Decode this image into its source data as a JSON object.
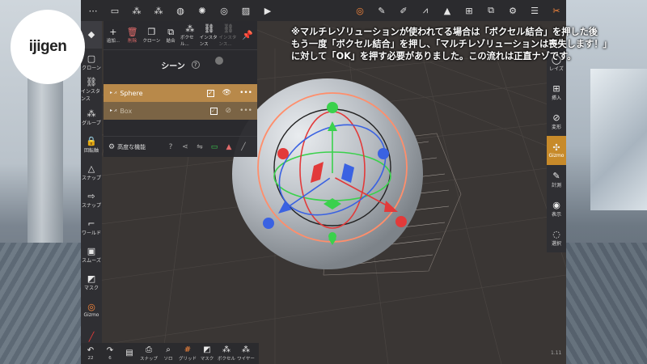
{
  "logo": {
    "text": "ijigen"
  },
  "caption": {
    "lines": [
      "※マルチレゾリューションが使われてる場合は「ボクセル結合」を押した後",
      "もう一度「ボクセル結合」を押し、「マルチレゾリューションは喪失します！」",
      "に対して「OK」を押す必要がありました。この流れは正直ナゾです。"
    ]
  },
  "scene_panel": {
    "tools": [
      {
        "icon": "+",
        "label": "追加..."
      },
      {
        "icon": "🗑",
        "label": "削除"
      },
      {
        "icon": "❐",
        "label": "クローン"
      },
      {
        "icon": "⧉",
        "label": "結合"
      },
      {
        "icon": "⁂",
        "label": "ボクセル..."
      },
      {
        "icon": "⛓",
        "label": "インスタンス"
      },
      {
        "icon": "⛓",
        "label": "インスタンス..."
      },
      {
        "icon": "📌",
        "label": ""
      }
    ],
    "title": "シーン",
    "help": "?",
    "objects": [
      {
        "name": "Sphere",
        "checked": "✓",
        "eye": "👁",
        "more": "•••"
      },
      {
        "name": "Box",
        "checked": "✓",
        "eye": "⊘",
        "more": "•••"
      }
    ],
    "advanced": "高度な機能"
  },
  "left_toolbar": [
    {
      "icon": "◆",
      "label": ""
    },
    {
      "icon": "▢",
      "label": "クローン"
    },
    {
      "icon": "⛓",
      "label": "インスタンス"
    },
    {
      "icon": "⁂",
      "label": "グループ"
    },
    {
      "icon": "🔒",
      "label": "回転軸"
    },
    {
      "icon": "△",
      "label": "スナップ"
    },
    {
      "icon": "⇨",
      "label": "スナップ"
    },
    {
      "icon": "⌐",
      "label": "ワールド"
    },
    {
      "icon": "▣",
      "label": "スムーズ"
    },
    {
      "icon": "◩",
      "label": "マスク"
    },
    {
      "icon": "◎",
      "label": "Gizmo"
    },
    {
      "icon": "╱",
      "label": ""
    }
  ],
  "right_toolbar": [
    {
      "icon": "◯",
      "label": "レイズ"
    },
    {
      "icon": "⊞",
      "label": "挿入"
    },
    {
      "icon": "⊘",
      "label": "変形"
    },
    {
      "icon": "✣",
      "label": "Gizmo"
    },
    {
      "icon": "✎",
      "label": "計測"
    },
    {
      "icon": "◉",
      "label": "表示"
    },
    {
      "icon": "◌",
      "label": "選択"
    }
  ],
  "bottom_toolbar": [
    {
      "icon": "↶",
      "label": "22"
    },
    {
      "icon": "↷",
      "label": "6"
    },
    {
      "icon": "▤",
      "label": ""
    },
    {
      "icon": "⎙",
      "label": "スナップ"
    },
    {
      "icon": "⌕",
      "label": "ソロ"
    },
    {
      "icon": "#",
      "label": "グリッド"
    },
    {
      "icon": "◩",
      "label": "マスク"
    },
    {
      "icon": "⁂",
      "label": "ボクセル"
    },
    {
      "icon": "⁂",
      "label": "ワイヤー"
    }
  ],
  "corner_number": "1.11"
}
